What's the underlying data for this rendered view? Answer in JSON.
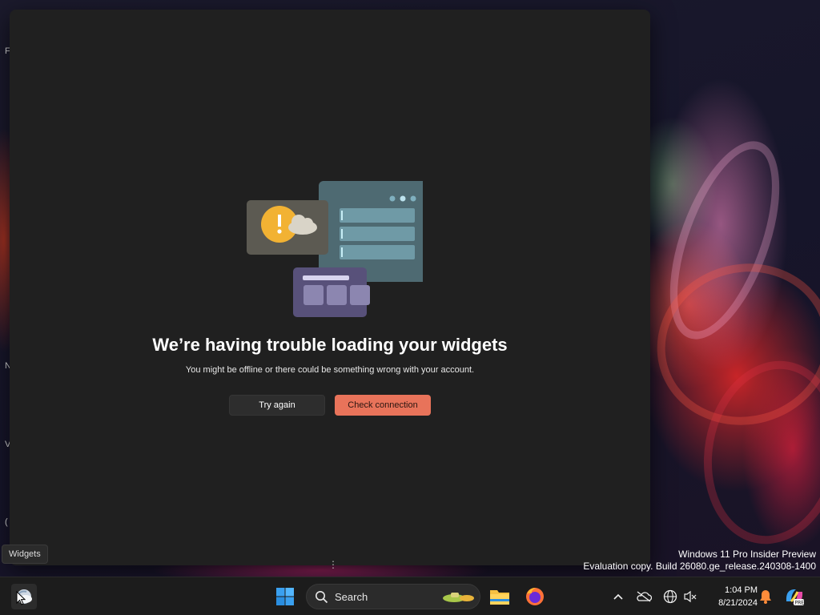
{
  "desktop": {
    "fragments": [
      "F",
      "N",
      "V",
      "("
    ]
  },
  "widgets_panel": {
    "title": "We’re having trouble loading your widgets",
    "subtitle": "You might be offline or there could be something wrong with your account.",
    "try_again_label": "Try again",
    "check_connection_label": "Check connection",
    "accent_color": "#e8735a"
  },
  "tooltip": {
    "text": "Widgets"
  },
  "watermark": {
    "line1": "Windows 11 Pro Insider Preview",
    "line2": "Evaluation copy. Build 26080.ge_release.240308-1400"
  },
  "taskbar": {
    "search_label": "Search",
    "clock_time": "1:04 PM",
    "clock_date": "8/21/2024",
    "icons": [
      "widgets-icon",
      "start-icon",
      "search-icon",
      "file-explorer-icon",
      "firefox-icon",
      "chevron-up-icon",
      "onedrive-icon",
      "network-icon",
      "volume-muted-icon",
      "notification-bell-icon",
      "copilot-icon"
    ]
  }
}
